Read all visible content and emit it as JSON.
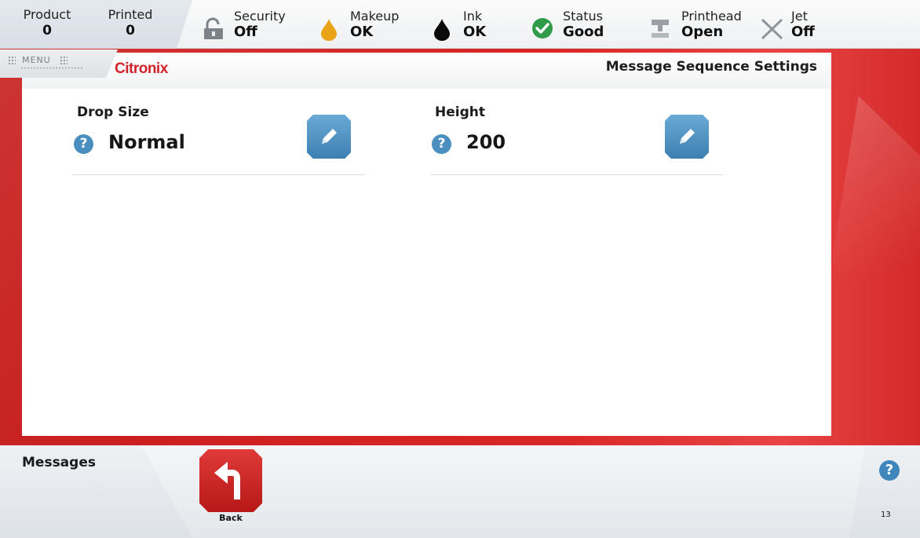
{
  "topbar": {
    "counters": [
      {
        "label": "Product",
        "value": "0"
      },
      {
        "label": "Printed",
        "value": "0"
      }
    ],
    "status": [
      {
        "label": "Security",
        "value": "Off",
        "icon": "padlock-open-icon"
      },
      {
        "label": "Makeup",
        "value": "OK",
        "icon": "makeup-drop-icon"
      },
      {
        "label": "Ink",
        "value": "OK",
        "icon": "ink-drop-icon"
      },
      {
        "label": "Status",
        "value": "Good",
        "icon": "status-check-icon"
      },
      {
        "label": "Printhead",
        "value": "Open",
        "icon": "printhead-icon"
      },
      {
        "label": "Jet",
        "value": "Off",
        "icon": "jet-x-icon"
      }
    ]
  },
  "header": {
    "menu_label": "MENU",
    "brand": "Citronix",
    "title": "Message Sequence Settings"
  },
  "settings": [
    {
      "label": "Drop Size",
      "value": "Normal"
    },
    {
      "label": "Height",
      "value": "200"
    }
  ],
  "bottom": {
    "title": "Messages",
    "back_label": "Back",
    "help_symbol": "?",
    "page_number": "13"
  },
  "colors": {
    "brand_red": "#d2232a",
    "frame_red": "#d92626",
    "edit_blue": "#4a8fc0",
    "makeup_amber": "#e8a317",
    "status_green": "#2f9a48"
  }
}
